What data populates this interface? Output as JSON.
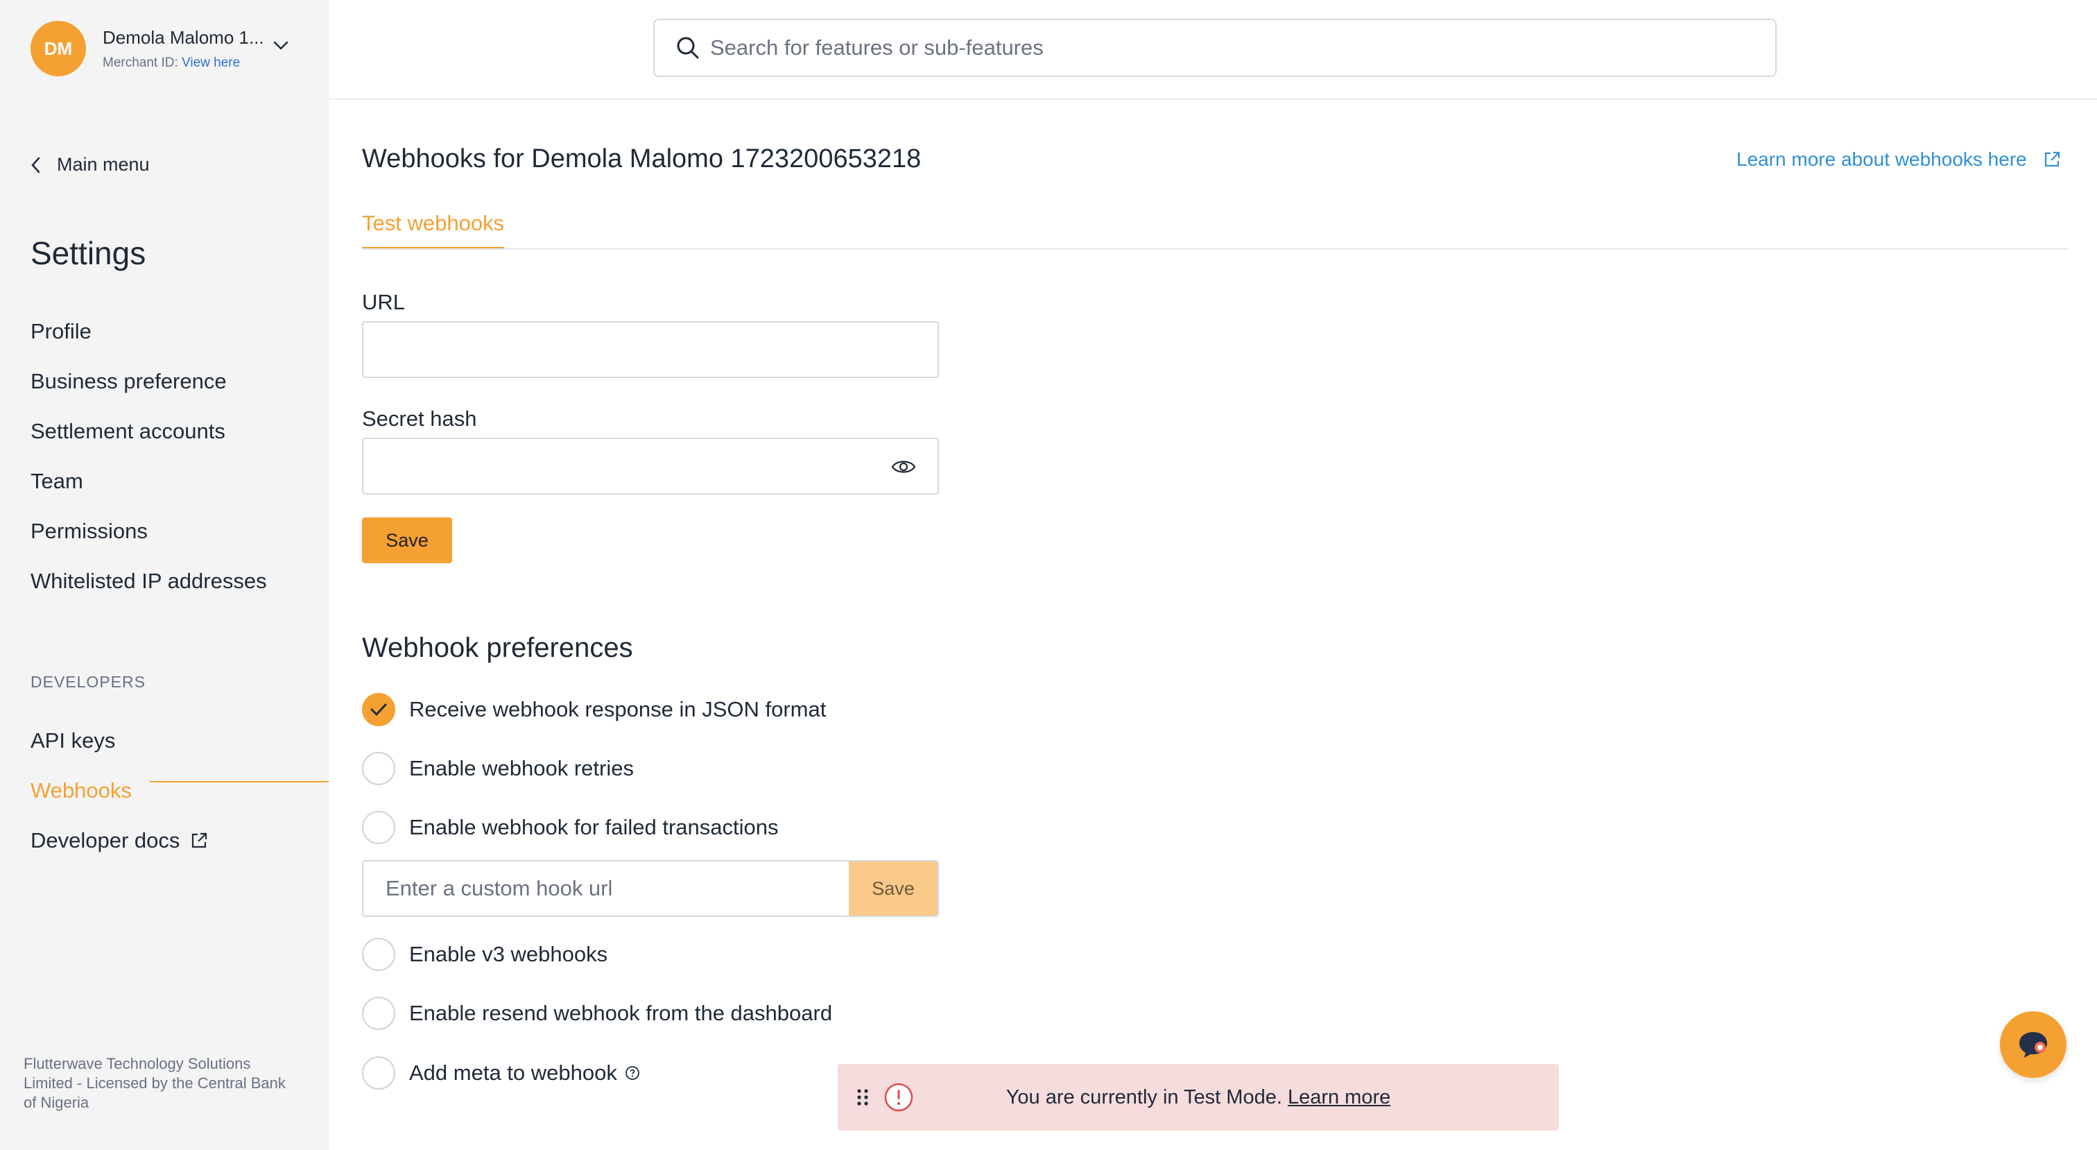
{
  "account": {
    "initials": "DM",
    "name": "Demola Malomo 1...",
    "merchant_label": "Merchant ID:",
    "merchant_link": "View here"
  },
  "sidebar": {
    "back_label": "Main menu",
    "title": "Settings",
    "items": [
      {
        "label": "Profile"
      },
      {
        "label": "Business preference"
      },
      {
        "label": "Settlement accounts"
      },
      {
        "label": "Team"
      },
      {
        "label": "Permissions"
      },
      {
        "label": "Whitelisted IP addresses"
      }
    ],
    "developers_label": "DEVELOPERS",
    "dev_items": [
      {
        "label": "API keys"
      },
      {
        "label": "Webhooks",
        "active": true
      },
      {
        "label": "Developer docs"
      }
    ],
    "footer": "Flutterwave Technology Solutions Limited - Licensed by the Central Bank of Nigeria"
  },
  "search": {
    "placeholder": "Search for features or sub-features"
  },
  "page": {
    "title": "Webhooks for Demola Malomo 1723200653218",
    "learn_more": "Learn more about webhooks here",
    "tab": "Test webhooks",
    "url_label": "URL",
    "url_value": "",
    "secret_label": "Secret hash",
    "secret_value": "",
    "save_label": "Save"
  },
  "preferences": {
    "title": "Webhook preferences",
    "items": [
      {
        "label": "Receive webhook response in JSON format",
        "checked": true
      },
      {
        "label": "Enable webhook retries",
        "checked": false
      },
      {
        "label": "Enable webhook for failed transactions",
        "checked": false
      },
      {
        "label": "Enable v3 webhooks",
        "checked": false
      },
      {
        "label": "Enable resend webhook from the dashboard",
        "checked": false
      },
      {
        "label": "Add meta to webhook",
        "checked": false
      }
    ],
    "custom_hook_placeholder": "Enter a custom hook url",
    "custom_hook_save": "Save"
  },
  "banner": {
    "text": "You are currently in Test Mode.",
    "link": "Learn more"
  },
  "colors": {
    "accent": "#f5a032",
    "link": "#2f8fd6",
    "banner_bg": "#f6dcdc"
  }
}
